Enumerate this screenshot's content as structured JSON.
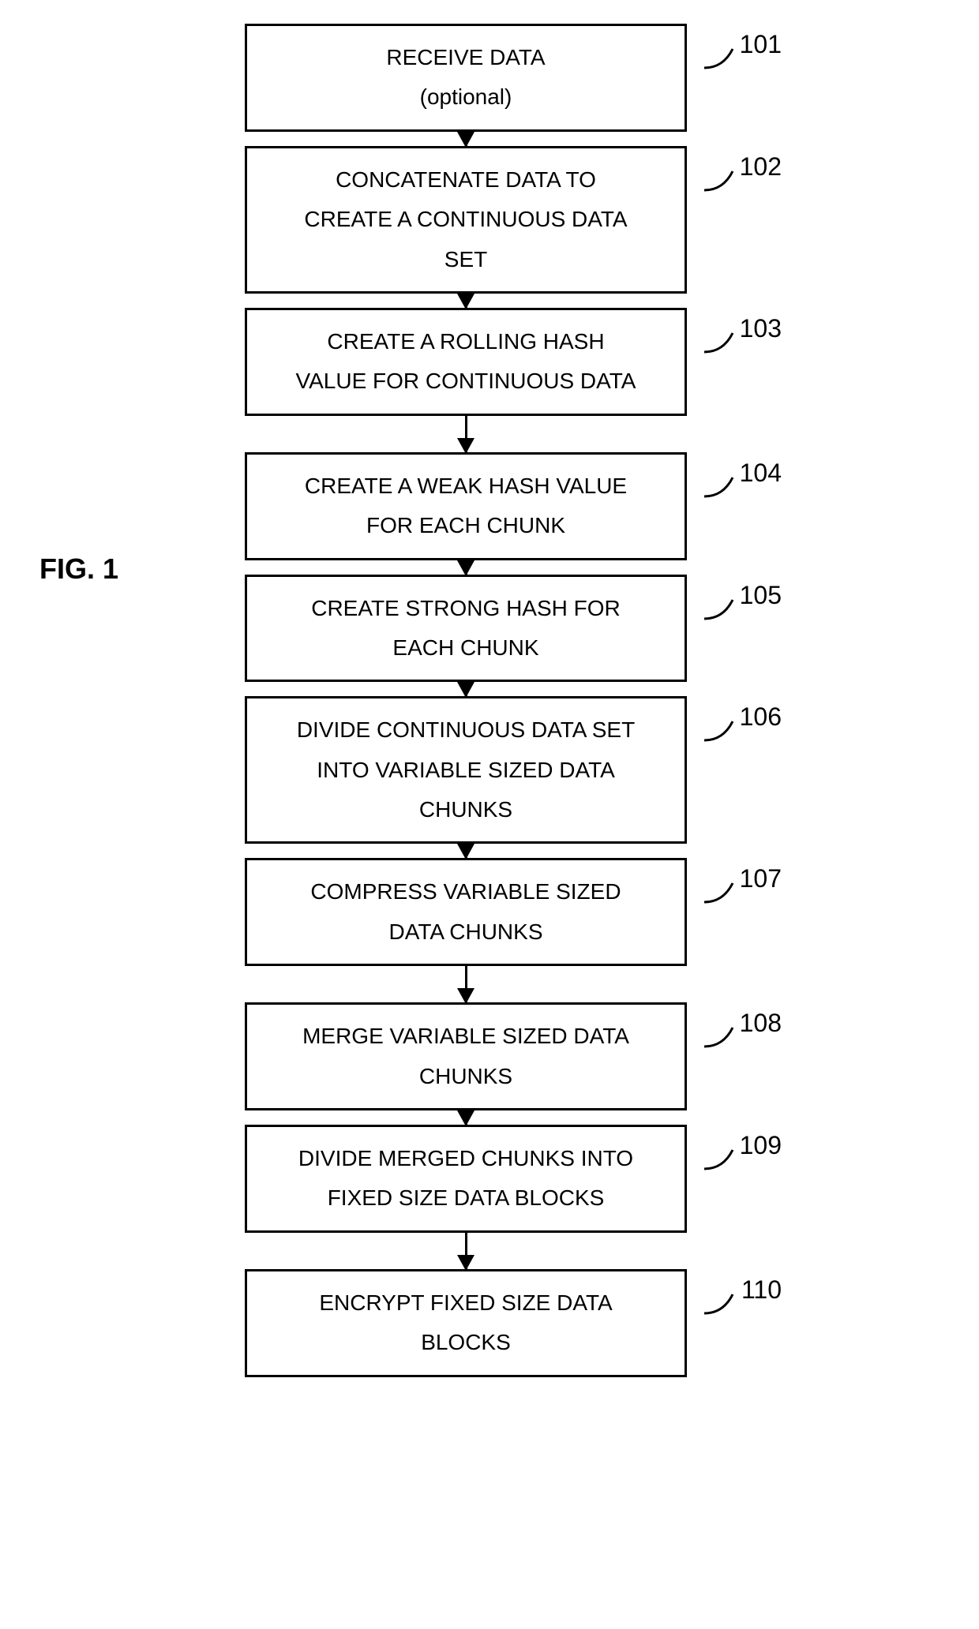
{
  "figure_label": "FIG. 1",
  "steps": [
    {
      "ref": "101",
      "line1": "RECEIVE DATA",
      "line2": "(optional)"
    },
    {
      "ref": "102",
      "line1": "CONCATENATE DATA TO",
      "line2": "CREATE A CONTINUOUS DATA",
      "line3": "SET"
    },
    {
      "ref": "103",
      "line1": "CREATE A ROLLING HASH",
      "line2": "VALUE FOR CONTINUOUS DATA"
    },
    {
      "ref": "104",
      "line1": "CREATE A WEAK HASH VALUE",
      "line2": "FOR EACH CHUNK"
    },
    {
      "ref": "105",
      "line1": "CREATE STRONG HASH FOR",
      "line2": "EACH CHUNK"
    },
    {
      "ref": "106",
      "line1": "DIVIDE CONTINUOUS DATA SET",
      "line2": "INTO VARIABLE SIZED DATA",
      "line3": "CHUNKS"
    },
    {
      "ref": "107",
      "line1": "COMPRESS VARIABLE SIZED",
      "line2": "DATA CHUNKS"
    },
    {
      "ref": "108",
      "line1": "MERGE VARIABLE SIZED DATA",
      "line2": "CHUNKS"
    },
    {
      "ref": "109",
      "line1": "DIVIDE MERGED CHUNKS INTO",
      "line2": "FIXED SIZE DATA BLOCKS"
    },
    {
      "ref": "110",
      "line1": "ENCRYPT FIXED SIZE DATA",
      "line2": "BLOCKS"
    }
  ]
}
